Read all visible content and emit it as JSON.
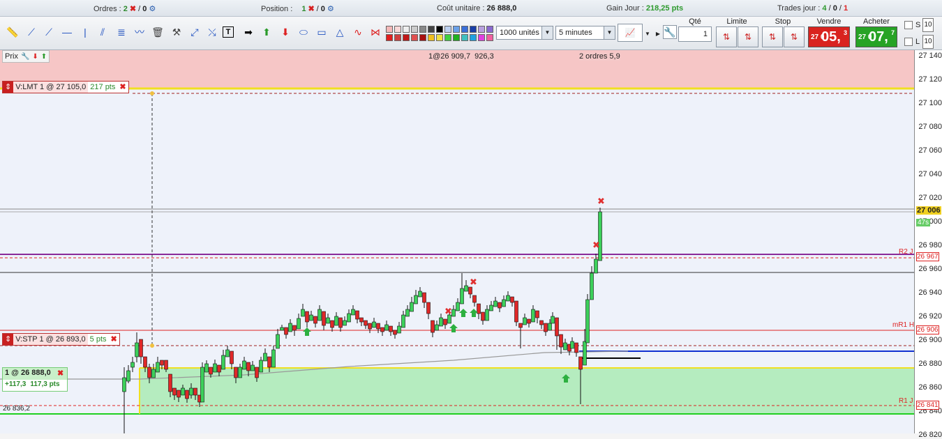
{
  "topbar": {
    "orders_label": "Ordres :",
    "orders_a": "2",
    "orders_b": "0",
    "position_label": "Position :",
    "position_a": "1",
    "position_b": "0",
    "unit_cost_label": "Coût unitaire :",
    "unit_cost_value": "26 888,0",
    "gain_label": "Gain Jour :",
    "gain_value": "218,25 pts",
    "trades_label": "Trades jour :",
    "trades_a": "4",
    "trades_b": "0",
    "trades_c": "1"
  },
  "toolbar": {
    "units_value": "1000 unités",
    "timeframe_value": "5 minutes",
    "qty_header": "Qté",
    "qty_value": "1",
    "limit_header": "Limite",
    "stop_header": "Stop",
    "sell_header": "Vendre",
    "buy_header": "Acheter",
    "sell_prefix": "27 0",
    "sell_big": "05,",
    "sell_sup": "3",
    "buy_prefix": "27 0",
    "buy_big": "07,",
    "buy_sup": "7",
    "s_label": "S",
    "l_label": "L",
    "s_box": "10",
    "l_box": "10",
    "colors": {
      "sell": "#d9231f",
      "buy": "#27a325",
      "accent": "#1d4fbf"
    }
  },
  "chart": {
    "prix_label": "Prix",
    "top_order_1": "1@26 909,7",
    "top_order_2": "926,3",
    "top_order_3": "2 ordres",
    "top_order_4": "5,9",
    "lmt_tag": "V:LMT  1 @ 27 105,0",
    "lmt_pts": "217 pts",
    "stp_tag": "V:STP  1 @ 26 893,0",
    "stp_pts": "5 pts",
    "pos_tag": "1 @ 26 888,0",
    "pos_gain": "+117,3",
    "pos_pts": "117,3 pts",
    "low_label": "26 836,2",
    "r2": "R2 J",
    "mr1": "mR1 H",
    "r1": "R1 J",
    "timer": "47s"
  },
  "axis": {
    "ticks": [
      "27 140",
      "27 120",
      "27 100",
      "27 080",
      "27 060",
      "27 040",
      "27 020",
      "27 000",
      "26 980",
      "26 960",
      "26 940",
      "26 920",
      "26 900",
      "26 880",
      "26 860",
      "26 840",
      "26 820"
    ],
    "current": "27 006",
    "r2_value": "26 967",
    "mr1_value": "26 906",
    "r1_value": "26 841"
  }
}
